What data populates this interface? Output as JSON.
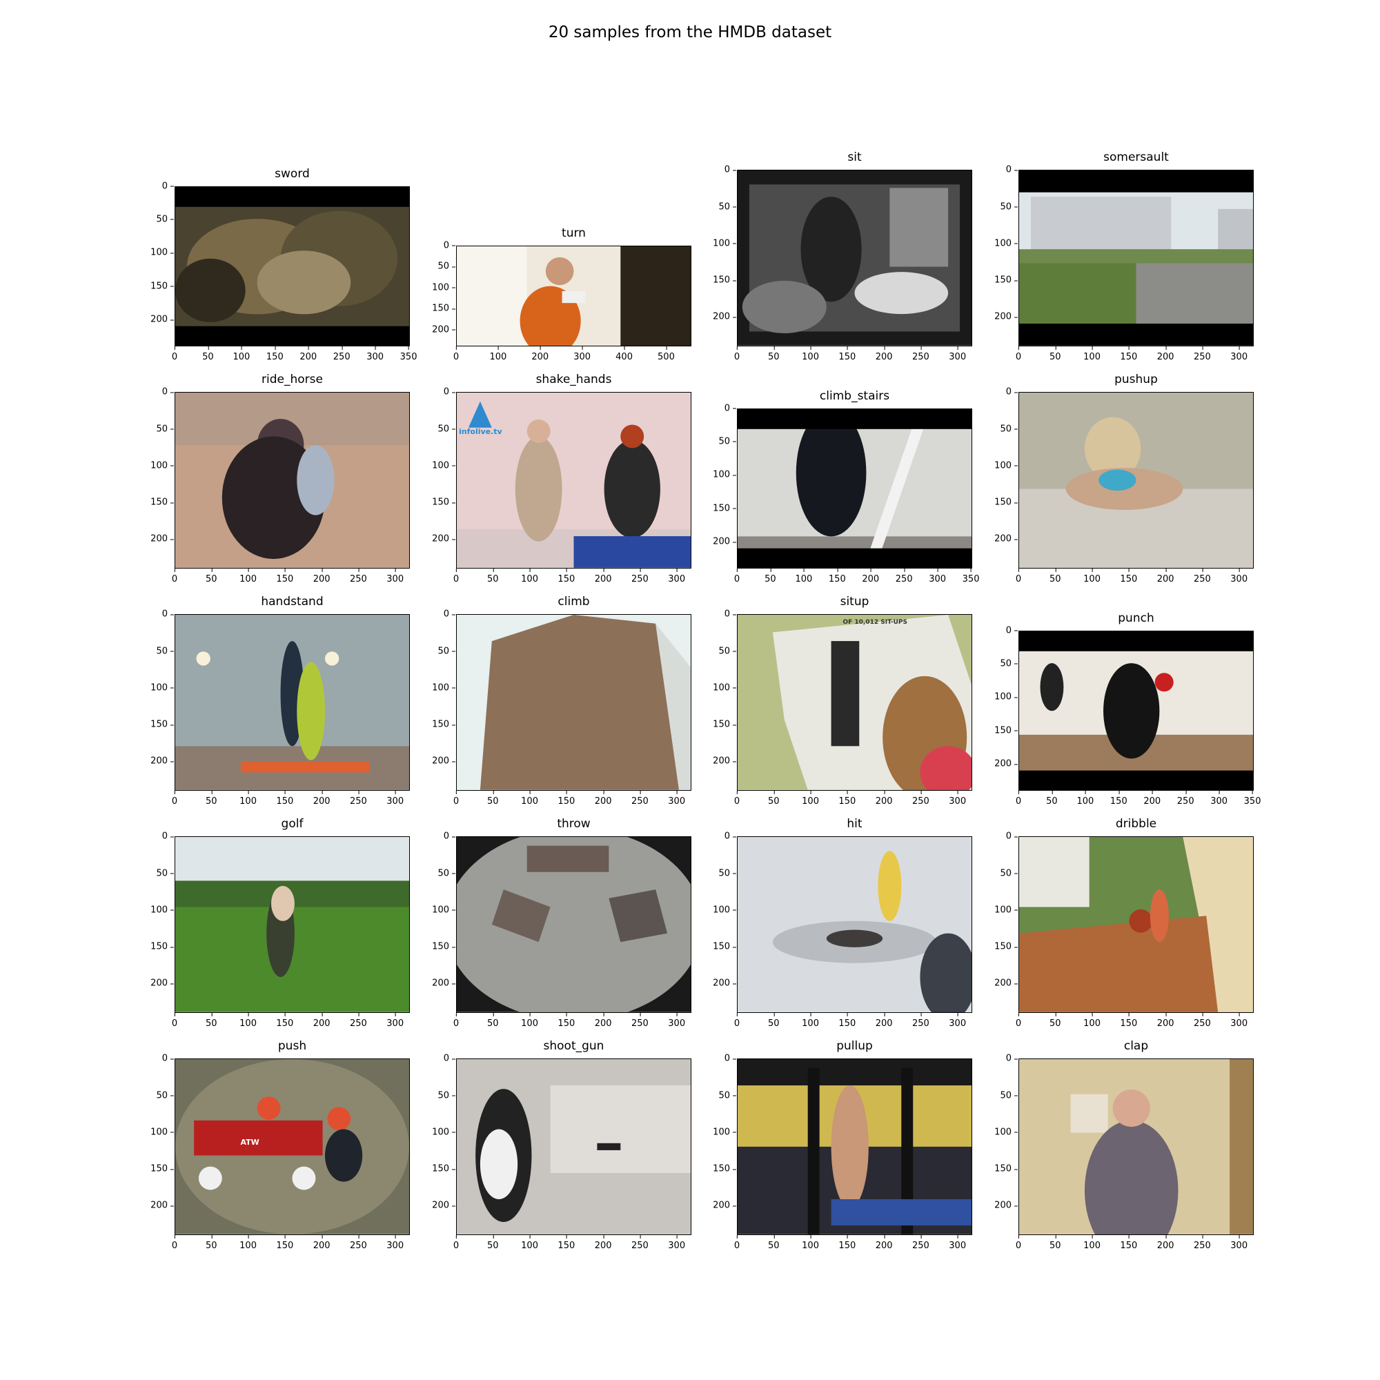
{
  "figure_title": "20 samples from the HMDB dataset",
  "panels": [
    {
      "title": "sword",
      "x_ticks": [
        "0",
        "50",
        "100",
        "150",
        "200",
        "250",
        "300",
        "350"
      ],
      "x_range": [
        0,
        352
      ],
      "y_ticks": [
        "0",
        "50",
        "100",
        "150",
        "200"
      ],
      "y_range": [
        0,
        240
      ],
      "scene": "dark-blurry-crowd",
      "letterbox": [
        30,
        210
      ]
    },
    {
      "title": "turn",
      "x_ticks": [
        "0",
        "100",
        "200",
        "300",
        "400",
        "500"
      ],
      "x_range": [
        0,
        560
      ],
      "y_ticks": [
        "0",
        "50",
        "100",
        "150",
        "200"
      ],
      "y_range": [
        0,
        240
      ],
      "scene": "man-orange-window"
    },
    {
      "title": "sit",
      "x_ticks": [
        "0",
        "50",
        "100",
        "150",
        "200",
        "250",
        "300"
      ],
      "x_range": [
        0,
        320
      ],
      "y_ticks": [
        "0",
        "50",
        "100",
        "150",
        "200"
      ],
      "y_range": [
        0,
        240
      ],
      "scene": "bw-room"
    },
    {
      "title": "somersault",
      "x_ticks": [
        "0",
        "50",
        "100",
        "150",
        "200",
        "250",
        "300"
      ],
      "x_range": [
        0,
        320
      ],
      "y_ticks": [
        "0",
        "50",
        "100",
        "150",
        "200"
      ],
      "y_range": [
        0,
        240
      ],
      "scene": "building-lawn",
      "letterbox": [
        30,
        210
      ]
    },
    {
      "title": "ride_horse",
      "x_ticks": [
        "0",
        "50",
        "100",
        "150",
        "200",
        "250",
        "300"
      ],
      "x_range": [
        0,
        320
      ],
      "y_ticks": [
        "0",
        "50",
        "100",
        "150",
        "200"
      ],
      "y_range": [
        0,
        240
      ],
      "scene": "horse-rider"
    },
    {
      "title": "shake_hands",
      "x_ticks": [
        "0",
        "50",
        "100",
        "150",
        "200",
        "250",
        "300"
      ],
      "x_range": [
        0,
        320
      ],
      "y_ticks": [
        "0",
        "50",
        "100",
        "150",
        "200"
      ],
      "y_range": [
        0,
        240
      ],
      "scene": "handshake",
      "watermark": "infolive.tv"
    },
    {
      "title": "climb_stairs",
      "x_ticks": [
        "0",
        "50",
        "100",
        "150",
        "200",
        "250",
        "300",
        "350"
      ],
      "x_range": [
        0,
        352
      ],
      "y_ticks": [
        "0",
        "50",
        "100",
        "150",
        "200"
      ],
      "y_range": [
        0,
        240
      ],
      "scene": "stairs",
      "letterbox": [
        30,
        210
      ]
    },
    {
      "title": "pushup",
      "x_ticks": [
        "0",
        "50",
        "100",
        "150",
        "200",
        "250",
        "300"
      ],
      "x_range": [
        0,
        320
      ],
      "y_ticks": [
        "0",
        "50",
        "100",
        "150",
        "200"
      ],
      "y_range": [
        0,
        240
      ],
      "scene": "pushup"
    },
    {
      "title": "handstand",
      "x_ticks": [
        "0",
        "50",
        "100",
        "150",
        "200",
        "250",
        "300"
      ],
      "x_range": [
        0,
        320
      ],
      "y_ticks": [
        "0",
        "50",
        "100",
        "150",
        "200"
      ],
      "y_range": [
        0,
        240
      ],
      "scene": "handstand"
    },
    {
      "title": "climb",
      "x_ticks": [
        "0",
        "50",
        "100",
        "150",
        "200",
        "250",
        "300"
      ],
      "x_range": [
        0,
        320
      ],
      "y_ticks": [
        "0",
        "50",
        "100",
        "150",
        "200"
      ],
      "y_range": [
        0,
        240
      ],
      "scene": "tower"
    },
    {
      "title": "situp",
      "x_ticks": [
        "0",
        "50",
        "100",
        "150",
        "200",
        "250",
        "300"
      ],
      "x_range": [
        0,
        320
      ],
      "y_ticks": [
        "0",
        "50",
        "100",
        "150",
        "200"
      ],
      "y_range": [
        0,
        240
      ],
      "scene": "situp-chart",
      "sign_text": "OF 10,012 SIT-UPS"
    },
    {
      "title": "punch",
      "x_ticks": [
        "0",
        "50",
        "100",
        "150",
        "200",
        "250",
        "300",
        "350"
      ],
      "x_range": [
        0,
        352
      ],
      "y_ticks": [
        "0",
        "50",
        "100",
        "150",
        "200"
      ],
      "y_range": [
        0,
        240
      ],
      "scene": "boxing",
      "letterbox": [
        30,
        210
      ]
    },
    {
      "title": "golf",
      "x_ticks": [
        "0",
        "50",
        "100",
        "150",
        "200",
        "250",
        "300"
      ],
      "x_range": [
        0,
        320
      ],
      "y_ticks": [
        "0",
        "50",
        "100",
        "150",
        "200"
      ],
      "y_range": [
        0,
        240
      ],
      "scene": "golf"
    },
    {
      "title": "throw",
      "x_ticks": [
        "0",
        "50",
        "100",
        "150",
        "200",
        "250",
        "300"
      ],
      "x_range": [
        0,
        320
      ],
      "y_ticks": [
        "0",
        "50",
        "100",
        "150",
        "200"
      ],
      "y_range": [
        0,
        240
      ],
      "scene": "fisheye-room"
    },
    {
      "title": "hit",
      "x_ticks": [
        "0",
        "50",
        "100",
        "150",
        "200",
        "250",
        "300"
      ],
      "x_range": [
        0,
        320
      ],
      "y_ticks": [
        "0",
        "50",
        "100",
        "150",
        "200"
      ],
      "y_range": [
        0,
        240
      ],
      "scene": "ice-hit"
    },
    {
      "title": "dribble",
      "x_ticks": [
        "0",
        "50",
        "100",
        "150",
        "200",
        "250",
        "300"
      ],
      "x_range": [
        0,
        320
      ],
      "y_ticks": [
        "0",
        "50",
        "100",
        "150",
        "200"
      ],
      "y_range": [
        0,
        240
      ],
      "scene": "dribble"
    },
    {
      "title": "push",
      "x_ticks": [
        "0",
        "50",
        "100",
        "150",
        "200",
        "250",
        "300"
      ],
      "x_range": [
        0,
        320
      ],
      "y_ticks": [
        "0",
        "50",
        "100",
        "150",
        "200"
      ],
      "y_range": [
        0,
        240
      ],
      "scene": "wagon",
      "wagon_text": "ATW"
    },
    {
      "title": "shoot_gun",
      "x_ticks": [
        "0",
        "50",
        "100",
        "150",
        "200",
        "250",
        "300"
      ],
      "x_range": [
        0,
        320
      ],
      "y_ticks": [
        "0",
        "50",
        "100",
        "150",
        "200"
      ],
      "y_range": [
        0,
        240
      ],
      "scene": "range"
    },
    {
      "title": "pullup",
      "x_ticks": [
        "0",
        "50",
        "100",
        "150",
        "200",
        "250",
        "300"
      ],
      "x_range": [
        0,
        320
      ],
      "y_ticks": [
        "0",
        "50",
        "100",
        "150",
        "200"
      ],
      "y_range": [
        0,
        240
      ],
      "scene": "gym"
    },
    {
      "title": "clap",
      "x_ticks": [
        "0",
        "50",
        "100",
        "150",
        "200",
        "250",
        "300"
      ],
      "x_range": [
        0,
        320
      ],
      "y_ticks": [
        "0",
        "50",
        "100",
        "150",
        "200"
      ],
      "y_range": [
        0,
        240
      ],
      "scene": "clap"
    }
  ]
}
